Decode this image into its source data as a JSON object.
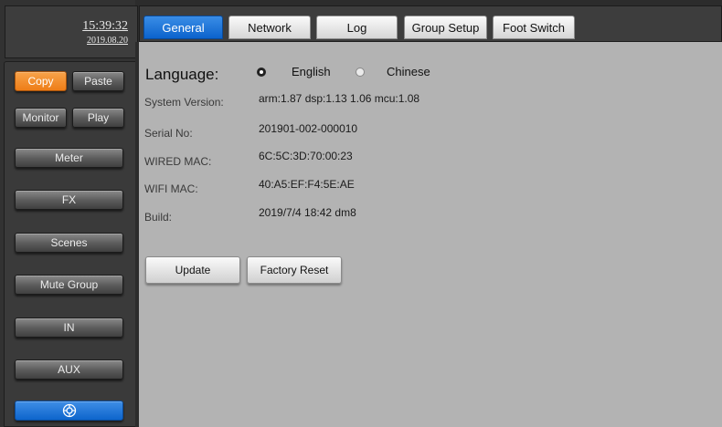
{
  "clock": {
    "time": "15:39:32",
    "date": "2019.08.20"
  },
  "sidebar": {
    "copy": "Copy",
    "paste": "Paste",
    "monitor": "Monitor",
    "play": "Play",
    "items": [
      "Meter",
      "FX",
      "Scenes",
      "Mute Group",
      "IN",
      "AUX"
    ],
    "bottom_icon": "settings-dial-icon"
  },
  "tabs": [
    "General",
    "Network",
    "Log",
    "Group Setup",
    "Foot Switch"
  ],
  "general": {
    "language_label": "Language:",
    "language_options": [
      "English",
      "Chinese"
    ],
    "language_selected": "English",
    "rows": [
      {
        "label": "System Version:",
        "value": "arm:1.87 dsp:1.13 1.06 mcu:1.08"
      },
      {
        "label": "Serial No:",
        "value": "201901-002-000010"
      },
      {
        "label": "WIRED MAC:",
        "value": "6C:5C:3D:70:00:23"
      },
      {
        "label": "WIFI MAC:",
        "value": "40:A5:EF:F4:5E:AE"
      },
      {
        "label": "Build:",
        "value": "2019/7/4 18:42 dm8"
      }
    ],
    "update_label": "Update",
    "factory_reset_label": "Factory Reset"
  },
  "colors": {
    "accent_orange": "#ee7d17",
    "accent_blue": "#0b63cc"
  }
}
